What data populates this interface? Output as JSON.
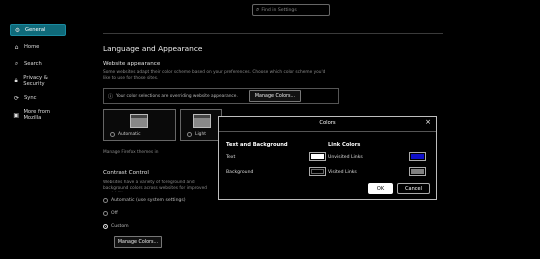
{
  "search": {
    "placeholder": "Find in Settings"
  },
  "sidebar": {
    "items": [
      {
        "label": "General"
      },
      {
        "label": "Home"
      },
      {
        "label": "Search"
      },
      {
        "label": "Privacy & Security"
      },
      {
        "label": "Sync"
      },
      {
        "label": "More from Mozilla"
      }
    ]
  },
  "main": {
    "section_title": "Language and Appearance",
    "website_appearance": {
      "heading": "Website appearance",
      "description": "Some websites adapt their color scheme based on your preferences. Choose which color scheme you'd like to use for those sites.",
      "notice": "Your color selections are overriding website appearance.",
      "manage_button": "Manage Colors...",
      "themes": [
        {
          "label": "Automatic"
        },
        {
          "label": "Light"
        },
        {
          "label": ""
        }
      ],
      "manage_themes": "Manage Firefox themes in"
    },
    "contrast_control": {
      "heading": "Contrast Control",
      "description": "Websites have a variety of foreground and background colors across websites for improved readability.",
      "options": [
        {
          "label": "Automatic (use system settings)",
          "checked": false
        },
        {
          "label": "Off",
          "checked": false
        },
        {
          "label": "Custom",
          "checked": true
        }
      ],
      "manage_button": "Manage Colors..."
    }
  },
  "dialog": {
    "title": "Colors",
    "close": "×",
    "text_bg_heading": "Text and Background",
    "link_heading": "Link Colors",
    "text_label": "Text",
    "background_label": "Background",
    "unvisited_label": "Unvisited Links",
    "visited_label": "Visited Links",
    "ok": "OK",
    "cancel": "Cancel",
    "colors": {
      "text": "#ffffff",
      "background": "#000000",
      "unvisited": "#1010c8",
      "visited": "#808080"
    }
  }
}
